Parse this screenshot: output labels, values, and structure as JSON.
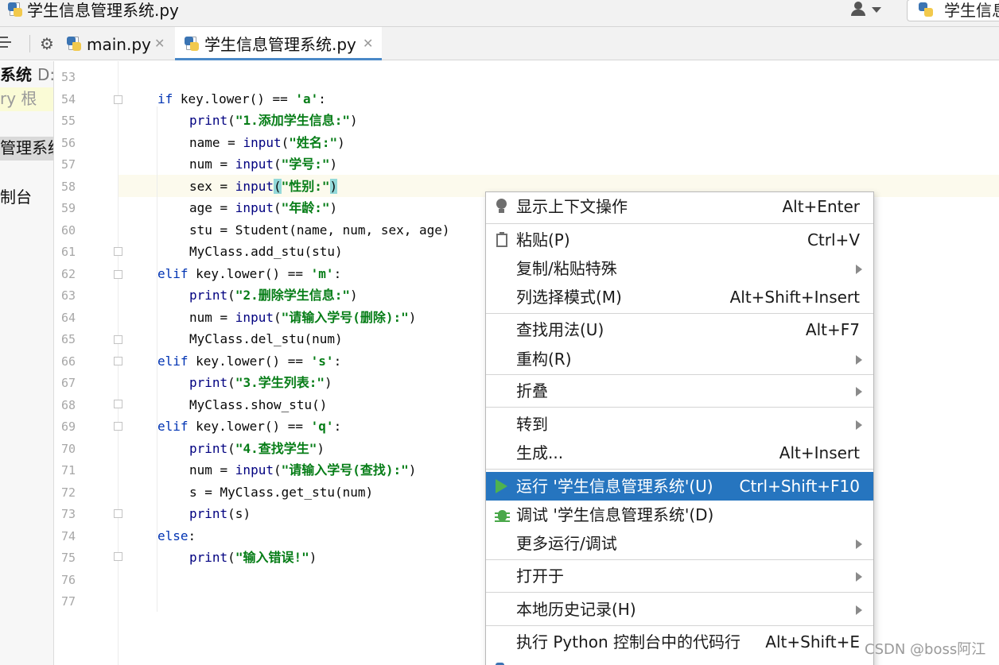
{
  "window": {
    "title": "学生信息管理系统.py",
    "run_config": "学生信息"
  },
  "tabs": [
    {
      "label": "main.py",
      "active": false
    },
    {
      "label": "学生信息管理系统.py",
      "active": true
    }
  ],
  "project": {
    "root_name": "系统",
    "root_path": "D:\\",
    "scratches": "ry 根",
    "selected_file": "管理系统.",
    "console": "制台"
  },
  "editor": {
    "current_line": 58,
    "line_numbers": [
      "53",
      "54",
      "55",
      "56",
      "57",
      "58",
      "59",
      "60",
      "61",
      "62",
      "63",
      "64",
      "65",
      "66",
      "67",
      "68",
      "69",
      "70",
      "71",
      "72",
      "73",
      "74",
      "75",
      "76",
      "77"
    ],
    "code": {
      "l54": {
        "kw": "if",
        "a": " key.lower() == ",
        "s": "'a'",
        "b": ":"
      },
      "l55": {
        "fn": "print",
        "a": "(",
        "s": "\"1.添加学生信息:\"",
        "b": ")"
      },
      "l56": {
        "a": "name = ",
        "fn": "input",
        "b": "(",
        "s": "\"姓名:\"",
        "c": ")"
      },
      "l57": {
        "a": "num = ",
        "fn": "input",
        "b": "(",
        "s": "\"学号:\"",
        "c": ")"
      },
      "l58": {
        "a": "sex = ",
        "fn": "input",
        "b": "(",
        "s": "\"性别:\"",
        "c": ")"
      },
      "l59": {
        "a": "age = ",
        "fn": "input",
        "b": "(",
        "s": "\"年龄:\"",
        "c": ")"
      },
      "l60": {
        "a": "stu = Student(name, num, sex, age)"
      },
      "l61": {
        "a": "MyClass.add_stu(stu)"
      },
      "l62": {
        "kw": "elif",
        "a": " key.lower() == ",
        "s": "'m'",
        "b": ":"
      },
      "l63": {
        "fn": "print",
        "a": "(",
        "s": "\"2.删除学生信息:\"",
        "b": ")"
      },
      "l64": {
        "a": "num = ",
        "fn": "input",
        "b": "(",
        "s": "\"请输入学号(删除):\"",
        "c": ")"
      },
      "l65": {
        "a": "MyClass.del_stu(num)"
      },
      "l66": {
        "kw": "elif",
        "a": " key.lower() == ",
        "s": "'s'",
        "b": ":"
      },
      "l67": {
        "fn": "print",
        "a": "(",
        "s": "\"3.学生列表:\"",
        "b": ")"
      },
      "l68": {
        "a": "MyClass.show_stu()"
      },
      "l69": {
        "kw": "elif",
        "a": " key.lower() == ",
        "s": "'q'",
        "b": ":"
      },
      "l70": {
        "fn": "print",
        "a": "(",
        "s": "\"4.查找学生\"",
        "b": ")"
      },
      "l71": {
        "a": "num = ",
        "fn": "input",
        "b": "(",
        "s": "\"请输入学号(查找):\"",
        "c": ")"
      },
      "l72": {
        "a": "s = MyClass.get_stu(num)"
      },
      "l73": {
        "fn": "print",
        "a": "(s)"
      },
      "l74": {
        "kw": "else",
        "a": ":"
      },
      "l75": {
        "fn": "print",
        "a": "(",
        "s": "\"输入错误!\"",
        "b": ")"
      }
    }
  },
  "context_menu": {
    "items": [
      {
        "label": "显示上下文操作",
        "shortcut": "Alt+Enter",
        "icon": "lightbulb-icon"
      },
      {
        "label": "粘贴(P)",
        "shortcut": "Ctrl+V",
        "icon": "clipboard-icon"
      },
      {
        "label": "复制/粘贴特殊",
        "submenu": true
      },
      {
        "label": "列选择模式(M)",
        "shortcut": "Alt+Shift+Insert"
      },
      {
        "label": "查找用法(U)",
        "shortcut": "Alt+F7"
      },
      {
        "label": "重构(R)",
        "submenu": true
      },
      {
        "label": "折叠",
        "submenu": true
      },
      {
        "label": "转到",
        "submenu": true
      },
      {
        "label": "生成...",
        "shortcut": "Alt+Insert"
      },
      {
        "label": "运行 '学生信息管理系统'(U)",
        "shortcut": "Ctrl+Shift+F10",
        "icon": "run-icon",
        "selected": true
      },
      {
        "label": "调试 '学生信息管理系统'(D)",
        "icon": "debug-icon"
      },
      {
        "label": "更多运行/调试",
        "submenu": true
      },
      {
        "label": "打开于",
        "submenu": true
      },
      {
        "label": "本地历史记录(H)",
        "submenu": true
      },
      {
        "label": "执行 Python 控制台中的代码行",
        "shortcut": "Alt+Shift+E"
      }
    ],
    "selected_color": "#2675bf"
  },
  "watermark": "CSDN @boss阿江",
  "colors": {
    "keyword": "#0033b3",
    "string": "#067d17",
    "current_line": "#fcfaed"
  }
}
